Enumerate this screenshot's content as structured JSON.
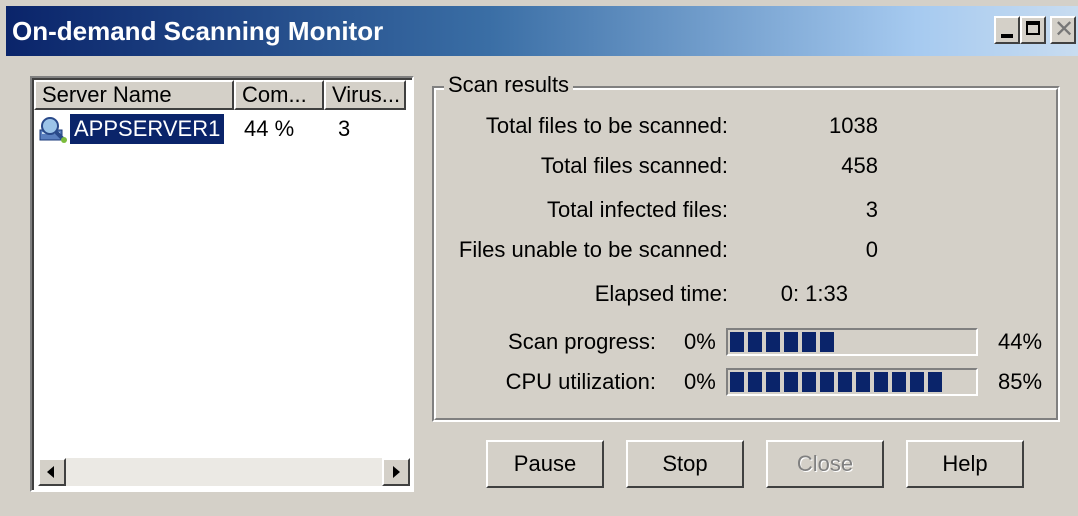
{
  "window": {
    "title": "On-demand Scanning Monitor"
  },
  "list": {
    "columns": [
      "Server Name",
      "Com...",
      "Virus..."
    ],
    "rows": [
      {
        "name": "APPSERVER1",
        "completed": "44 %",
        "viruses": "3",
        "icon": "server-search-icon"
      }
    ]
  },
  "scan_results": {
    "title": "Scan results",
    "stats": [
      {
        "label": "Total files to be scanned:",
        "value": "1038"
      },
      {
        "label": "Total files scanned:",
        "value": "458"
      },
      {
        "label": "Total infected files:",
        "value": "3"
      },
      {
        "label": "Files unable to be scanned:",
        "value": "0"
      }
    ],
    "elapsed": {
      "label": "Elapsed time:",
      "value": "0: 1:33"
    },
    "bars": [
      {
        "label": "Scan progress:",
        "min": "0%",
        "max": "44%",
        "value": 0.44
      },
      {
        "label": "CPU utilization:",
        "min": "0%",
        "max": "85%",
        "value": 0.85
      }
    ]
  },
  "buttons": {
    "pause": "Pause",
    "stop": "Stop",
    "close": "Close",
    "help": "Help"
  },
  "colors": {
    "titlebar_start": "#0a246a",
    "progress_fill": "#0a246a",
    "face": "#d4d0c8"
  }
}
